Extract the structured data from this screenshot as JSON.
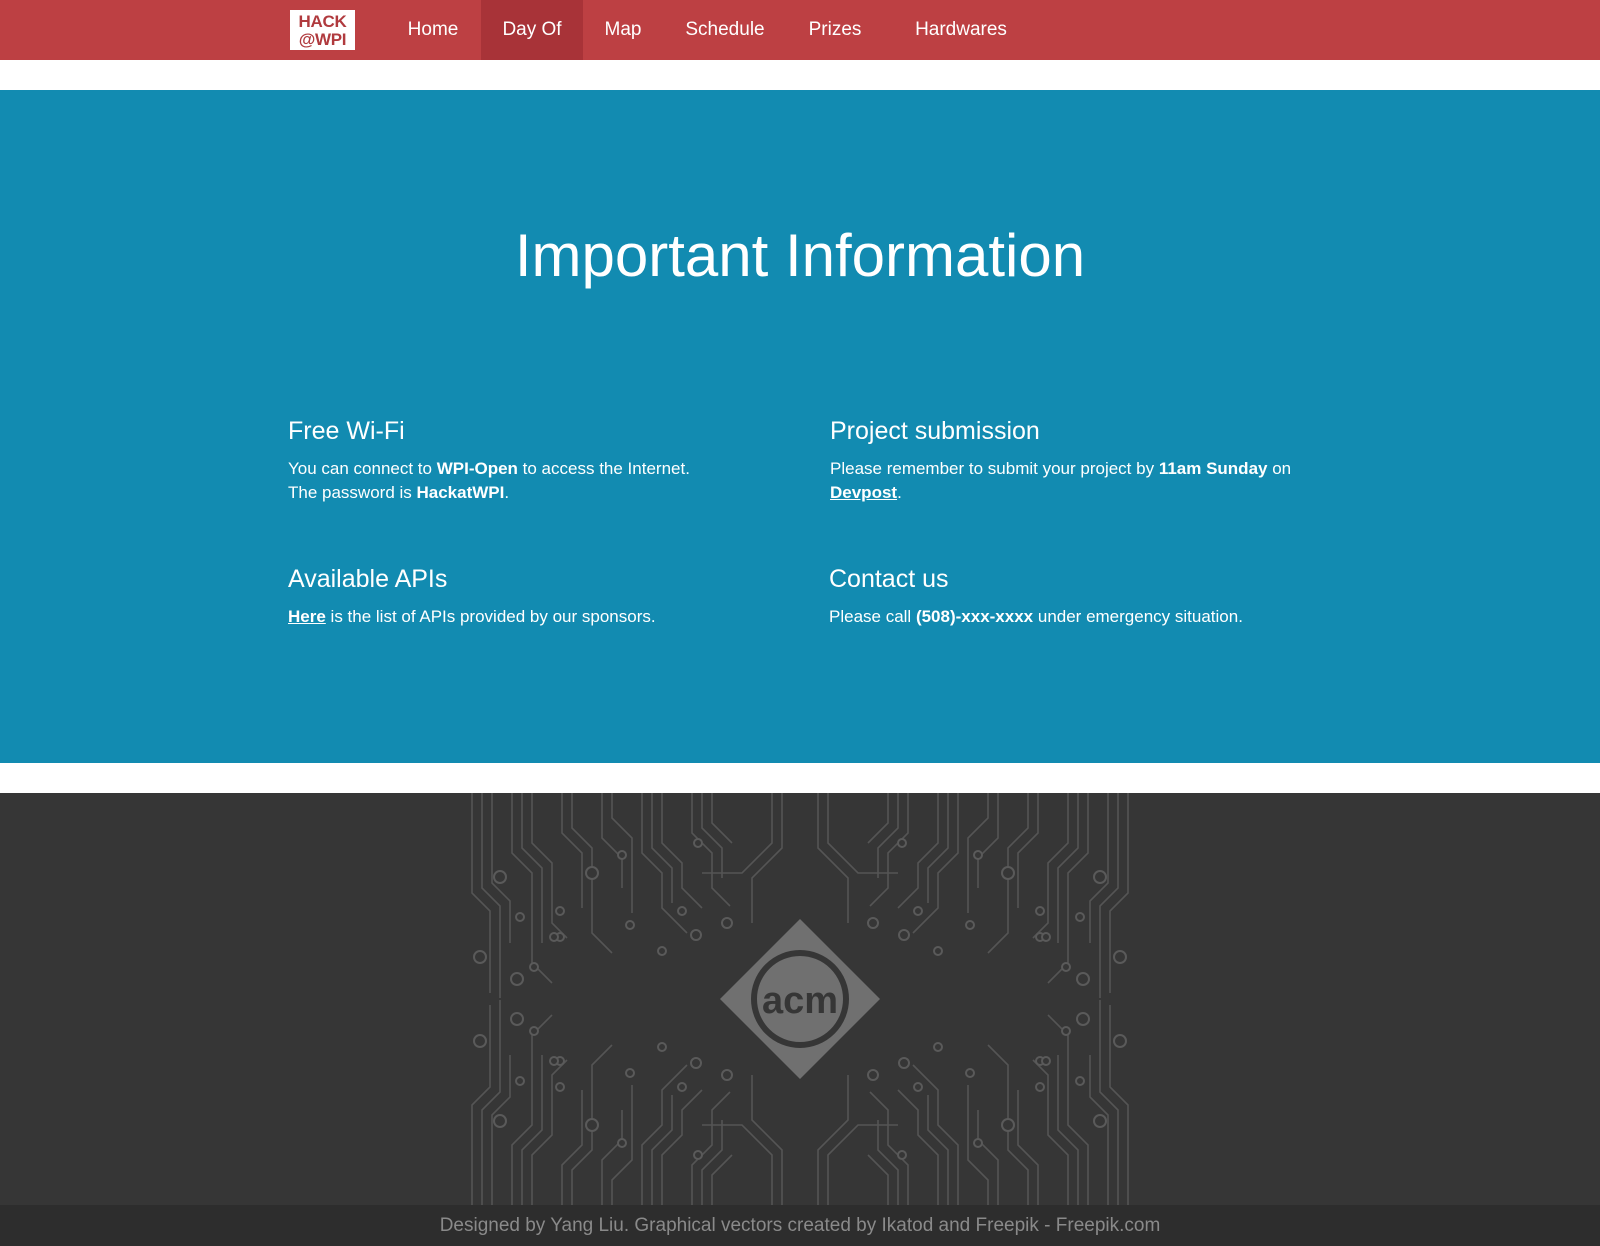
{
  "navbar": {
    "logo_line1": "HACK",
    "logo_line2": "@WPI",
    "items": [
      {
        "label": "Home"
      },
      {
        "label": "Day Of"
      },
      {
        "label": "Map"
      },
      {
        "label": "Schedule"
      },
      {
        "label": "Prizes"
      },
      {
        "label": "Hardwares"
      }
    ],
    "active_item": "Day Of"
  },
  "info": {
    "title": "Important Information",
    "wifi": {
      "heading": "Free Wi-Fi",
      "text1": "You can connect to ",
      "network": "WPI-Open",
      "text2": " to access the Internet.",
      "text3": "The password is ",
      "password": "HackatWPI",
      "text4": "."
    },
    "submission": {
      "heading": "Project submission",
      "text1": "Please remember to submit your project by ",
      "deadline": "11am Sunday",
      "text2": " on",
      "link": "Devpost",
      "text3": "."
    },
    "apis": {
      "heading": "Available APIs",
      "link": "Here",
      "text": " is the list of APIs provided by our sponsors."
    },
    "contact": {
      "heading": "Contact us",
      "text1": "Please call ",
      "phone": "(508)-xxx-xxxx",
      "text2": " under emergency situation."
    }
  },
  "footer": {
    "logo_text": "acm",
    "credits": "Designed by Yang Liu. Graphical vectors created by Ikatod and Freepik - Freepik.com"
  },
  "colors": {
    "navbar": "#bd4043",
    "navbar_active": "#a83338",
    "info_bg": "#128bb1",
    "footer_bg": "#363636",
    "footer_bar": "#2d2d2d"
  }
}
